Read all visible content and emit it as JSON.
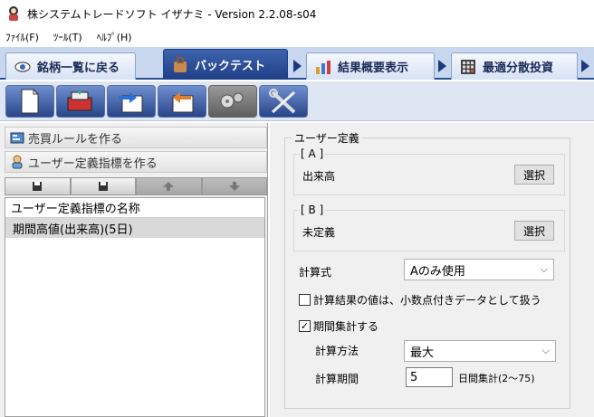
{
  "window": {
    "title": "株システムトレードソフト イザナミ - Version 2.2.08-s04"
  },
  "menu": {
    "items": [
      "ﾌｧｲﾙ(F)",
      "ﾂｰﾙ(T)",
      "ﾍﾙﾌﾟ(H)"
    ]
  },
  "tabs": [
    {
      "label": "銘柄一覧に戻る",
      "icon": "eye-icon"
    },
    {
      "label": "バックテスト",
      "icon": "bag-icon",
      "active": true
    },
    {
      "label": "結果概要表示",
      "icon": "chart-icon"
    },
    {
      "label": "最適分散投資",
      "icon": "calculator-icon"
    }
  ],
  "toolbar": {
    "buttons": [
      "new-document",
      "database",
      "export",
      "import",
      "settings-disabled",
      "tools"
    ]
  },
  "left": {
    "rules_label": "売買ルールを作る",
    "indicator_label": "ユーザー定義指標を作る",
    "list_header": "ユーザー定義指標の名称",
    "list_items": [
      "期間高値(出来高)(5日)"
    ]
  },
  "right": {
    "group_title": "ユーザー定義",
    "a_legend": "[ A ]",
    "a_value": "出来高",
    "b_legend": "[ B ]",
    "b_value": "未定義",
    "select_label": "選択",
    "formula_label": "計算式",
    "formula_value": "Aのみ使用",
    "decimal_check_label": "計算結果の値は、小数点付きデータとして扱う",
    "decimal_checked": false,
    "period_check_label": "期間集計する",
    "period_checked": true,
    "period_check_mark": "✓",
    "method_label": "計算方法",
    "method_value": "最大",
    "period_label": "計算期間",
    "period_value": "5",
    "period_unit": "日間集計(2～75)"
  },
  "colors": {
    "tab_active": "#1f3f86",
    "toolbar_btn": "#29458a",
    "selected_row": "#d9d9d9"
  }
}
